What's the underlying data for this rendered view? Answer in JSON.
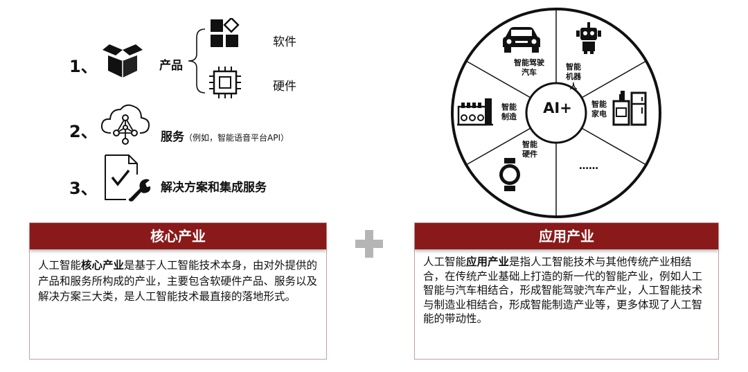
{
  "items": [
    {
      "number": "1、",
      "label": "产品"
    },
    {
      "number": "2、",
      "label": "服务",
      "note": "（例如，智能语音平台API）"
    },
    {
      "number": "3、",
      "label": "解决方案和集成服务"
    }
  ],
  "product_sub": {
    "software": "软件",
    "hardware": "硬件"
  },
  "wheel": {
    "center": "AI+",
    "segments": {
      "car": "智能驾驶汽车",
      "robot": "智能机器人",
      "appliance": "智能家电",
      "manufacturing": "智能制造",
      "hardware": "智能硬件",
      "more": "……"
    }
  },
  "core": {
    "title": "核心产业",
    "text_pre": "人工智能",
    "text_bold": "核心产业",
    "text_post": "是基于人工智能技术本身，由对外提供的产品和服务所构成的产业，主要包含软硬件产品、服务以及解决方案三大类，是人工智能技术最直接的落地形式。"
  },
  "applied": {
    "title": "应用产业",
    "text_pre": "人工智能",
    "text_bold": "应用产业",
    "text_post": "是指人工智能技术与其他传统产业相结合，在传统产业基础上打造的新一代的智能产业，例如人工智能与汽车相结合，形成智能驾驶汽车产业，人工智能技术与制造业相结合，形成智能制造产业等，更多体现了人工智能的带动性。"
  },
  "colors": {
    "header_bg": "#8a1a1a",
    "plus": "#b5b5b5",
    "border": "#c4a0a0"
  }
}
